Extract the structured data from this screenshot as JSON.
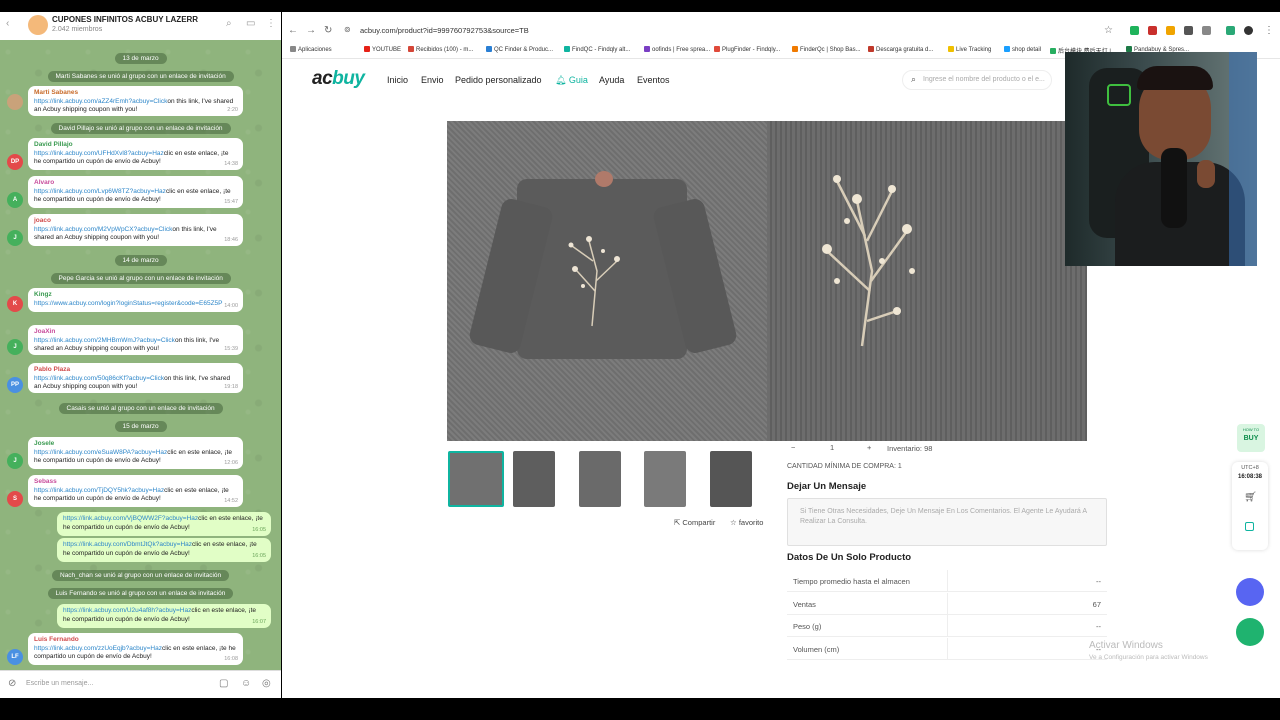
{
  "telegram": {
    "title": "CUPONES INFINITOS ACBUY LAZERR",
    "members": "2.042 miembros",
    "input_placeholder": "Escribe un mensaje...",
    "items": [
      {
        "kind": "date",
        "text": "13 de marzo"
      },
      {
        "kind": "service",
        "text": "Marti Sabanes se unió al grupo con un enlace de invitación"
      },
      {
        "kind": "msg",
        "name": "Marti Sabanes",
        "link": "https://link.acbuy.com/aZZ4rEmh?acbuy=Click",
        "text": "on this link, I've shared an Acbuy shipping coupon with you!",
        "time": "2:20"
      },
      {
        "kind": "service",
        "text": "David Pillajo se unió al grupo con un enlace de invitación"
      },
      {
        "kind": "msg",
        "name": "David Pillajo",
        "initials": "DP",
        "link": "https://link.acbuy.com/UFHdXvl8?acbuy=Haz",
        "text": "clic en este enlace, ¡te he compartido un cupón de envío de Acbuy!",
        "time": "14:38"
      },
      {
        "kind": "msg",
        "name": "Alvaro",
        "initials": "A",
        "link": "https://link.acbuy.com/Lvp6W8TZ?acbuy=Haz",
        "text": "clic en este enlace, ¡te he compartido un cupón de envío de Acbuy!",
        "time": "15:47"
      },
      {
        "kind": "msg",
        "name": "joaco",
        "initials": "J",
        "link": "https://link.acbuy.com/M2VpWpCX?acbuy=Click",
        "text": "on this link, I've shared an Acbuy shipping coupon with you!",
        "time": "18:46"
      },
      {
        "kind": "date",
        "text": "14 de marzo"
      },
      {
        "kind": "service",
        "text": "Pepe Garcia se unió al grupo con un enlace de invitación"
      },
      {
        "kind": "msg",
        "name": "Kingz",
        "initials": "K",
        "link": "https://www.acbuy.com/login?loginStatus=register&code=E65Z5P",
        "text": "",
        "time": "14:00"
      },
      {
        "kind": "msg",
        "name": "JoaXin",
        "initials": "J",
        "link": "https://link.acbuy.com/2MHBmWmJ?acbuy=Click",
        "text": "on this link, I've shared an Acbuy shipping coupon with you!",
        "time": "15:39"
      },
      {
        "kind": "msg",
        "name": "Pablo Plaza",
        "initials": "PP",
        "link": "https://link.acbuy.com/50q86cKf?acbuy=Click",
        "text": "on this link, I've shared an Acbuy shipping coupon with you!",
        "time": "19:18"
      },
      {
        "kind": "service",
        "text": "Casais se unió al grupo con un enlace de invitación"
      },
      {
        "kind": "date",
        "text": "15 de marzo"
      },
      {
        "kind": "msg",
        "name": "Josele",
        "initials": "J",
        "link": "https://link.acbuy.com/eSuaW8PA?acbuy=Haz",
        "text": "clic en este enlace, ¡te he compartido un cupón de envío de Acbuy!",
        "time": "12:06"
      },
      {
        "kind": "msg",
        "name": "Sebass",
        "initials": "S",
        "link": "https://link.acbuy.com/TjDQY5hk?acbuy=Haz",
        "text": "clic en este enlace, ¡te he compartido un cupón de envío de Acbuy!",
        "time": "14:52"
      },
      {
        "kind": "out",
        "link": "https://link.acbuy.com/VjBQWW2F?acbuy=Haz",
        "text": "clic en este enlace, ¡te he compartido un cupón de envío de Acbuy!",
        "time": "16:05"
      },
      {
        "kind": "out",
        "link": "https://link.acbuy.com/DbmtJtQk?acbuy=Haz",
        "text": "clic en este enlace, ¡te he compartido un cupón de envío de Acbuy!",
        "time": "16:05"
      },
      {
        "kind": "service",
        "text": "Nach_chan se unió al grupo con un enlace de invitación"
      },
      {
        "kind": "service",
        "text": "Luis Fernando se unió al grupo con un enlace de invitación"
      },
      {
        "kind": "out",
        "link": "https://link.acbuy.com/U2u4af8h?acbuy=Haz",
        "text": "clic en este enlace, ¡te he compartido un cupón de envío de Acbuy!",
        "time": "16:07"
      },
      {
        "kind": "msg",
        "name": "Luis Fernando",
        "initials": "LF",
        "link": "https://link.acbuy.com/zzUoEqjb?acbuy=Haz",
        "text": "clic en este enlace, ¡te he compartido un cupón de envío de Acbuy!",
        "time": "16:08"
      }
    ]
  },
  "browser": {
    "url": "acbuy.com/product?id=999760792753&source=TB",
    "bookmarks": [
      "Aplicaciones",
      "YOUTUBE",
      "Recibidos (100) - m...",
      "QC Finder & Produc...",
      "FindQC - Findqly alt...",
      "oofinds | Free sprea...",
      "PlugFinder - Findqly...",
      "FinderQc | Shop Bas...",
      "Descarga gratuita d...",
      "Live Tracking",
      "shop detail",
      "后台模块 费后天灯 |",
      "Pandabuy & Spres..."
    ]
  },
  "site": {
    "logo_a": "ac",
    "logo_b": "buy",
    "nav": [
      "Inicio",
      "Envio",
      "Pedido personalizado",
      "Guia",
      "Ayuda",
      "Eventos"
    ],
    "search_placeholder": "Ingrese el nombre del producto o el e...",
    "share": "Compartir",
    "favorite": "favorito",
    "quantity": "1",
    "inventory": "Inventario: 98",
    "min_purchase": "CANTIDAD MÍNIMA DE COMPRA: 1",
    "message_title": "Dejar Un Mensaje",
    "message_placeholder": "Si Tiene Otras Necesidades, Deje Un Mensaje En Los Comentarios. El Agente Le Ayudará A Realizar La Consulta.",
    "specs_title": "Datos De Un Solo Producto",
    "specs": [
      {
        "k": "Tiempo promedio hasta el almacen",
        "v": "--"
      },
      {
        "k": "Ventas",
        "v": "67"
      },
      {
        "k": "Peso (g)",
        "v": "--"
      },
      {
        "k": "Volumen (cm)",
        "v": "--"
      }
    ],
    "watermark_title": "Activar Windows",
    "watermark_sub": "Ve a Configuración para activar Windows"
  },
  "widgets": {
    "tz": "UTC+8",
    "clock": "16:08:38",
    "buy_badge": "BUY",
    "buy_top": "HOW TO"
  }
}
